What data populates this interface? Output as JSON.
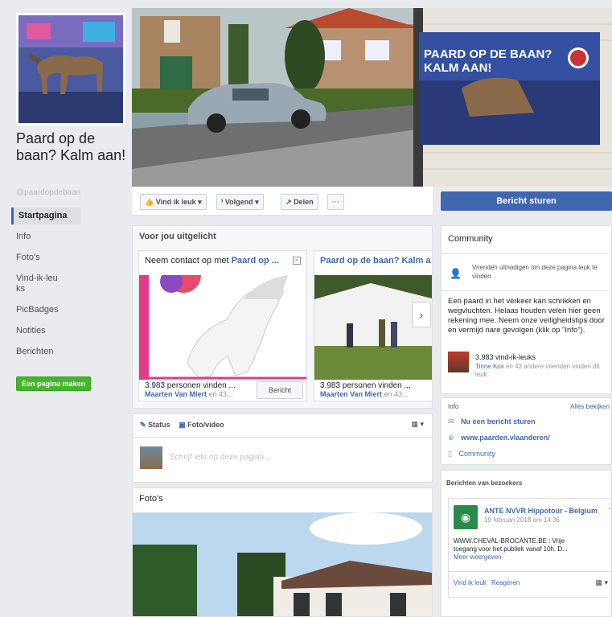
{
  "sidebar": {
    "page_name": "Paard op de baan? Kalm aan!",
    "handle": "@paardopdebaan",
    "items": [
      {
        "label": "Startpagina"
      },
      {
        "label": "Info"
      },
      {
        "label": "Foto's"
      },
      {
        "label": "Vind-ik-leuks"
      },
      {
        "label": "PicBadges"
      },
      {
        "label": "Notities"
      },
      {
        "label": "Berichten"
      }
    ],
    "create_page": "Een pagina maken"
  },
  "cover": {
    "poster_title": "PAARD OP DE BAAN? KALM AAN!"
  },
  "actions": {
    "like": "Vind ik leuk",
    "follow": "Volgend",
    "share": "Delen",
    "more": "···",
    "send_message": "Bericht sturen"
  },
  "featured": {
    "title": "Voor jou uitgelicht",
    "card1": {
      "prefix": "Neem contact op met ",
      "link": "Paard op ...",
      "likes": "3.983 personen vinden ...",
      "friend": "Maarten Van Miert",
      "friend_suffix": " en 43...",
      "button": "Bericht"
    },
    "card2": {
      "link": "Paard op de baan? Kalm a",
      "likes": "3.983 personen vinden ...",
      "friend": "Maarten Van Miert",
      "friend_suffix": " en 43..."
    }
  },
  "composer": {
    "status": "Status",
    "photo": "Foto/video",
    "placeholder": "Schrijf iets op deze pagina..."
  },
  "photos": {
    "title": "Foto's"
  },
  "community": {
    "title": "Community",
    "invite": "Vrienden uitnodigen om deze pagina leuk te vinden",
    "description": "Een paard in het verkeer kan schrikken en wegvluchten. Helaas houden velen hier geen rekening mee. Neem onze veiligheidstips door en vermijd nare gevolgen (klik op \"Info\").",
    "likes_count": "3.983 vind-ik-leuks",
    "friend": "Tinne Kox",
    "friend_suffix": " en 43 andere vrienden vinden dit leuk"
  },
  "info": {
    "title": "Info",
    "see_all": "Alles bekijken",
    "send_message": "Nu een bericht sturen",
    "website": "www.paarden.vlaanderen/",
    "category": "Community"
  },
  "visitors": {
    "title": "Berichten van bezoekers",
    "author": "ANTE NVVR Hippotour - Belgium",
    "date": "19 februari 2018 om 14:36",
    "text": "WWW.CHEVAL-BROCANTE.BE : Vrije toegang voor het publiek vanaf 10h. D...",
    "more": "Meer weergeven",
    "like": "Vind ik leuk",
    "reply": "Reageren"
  }
}
